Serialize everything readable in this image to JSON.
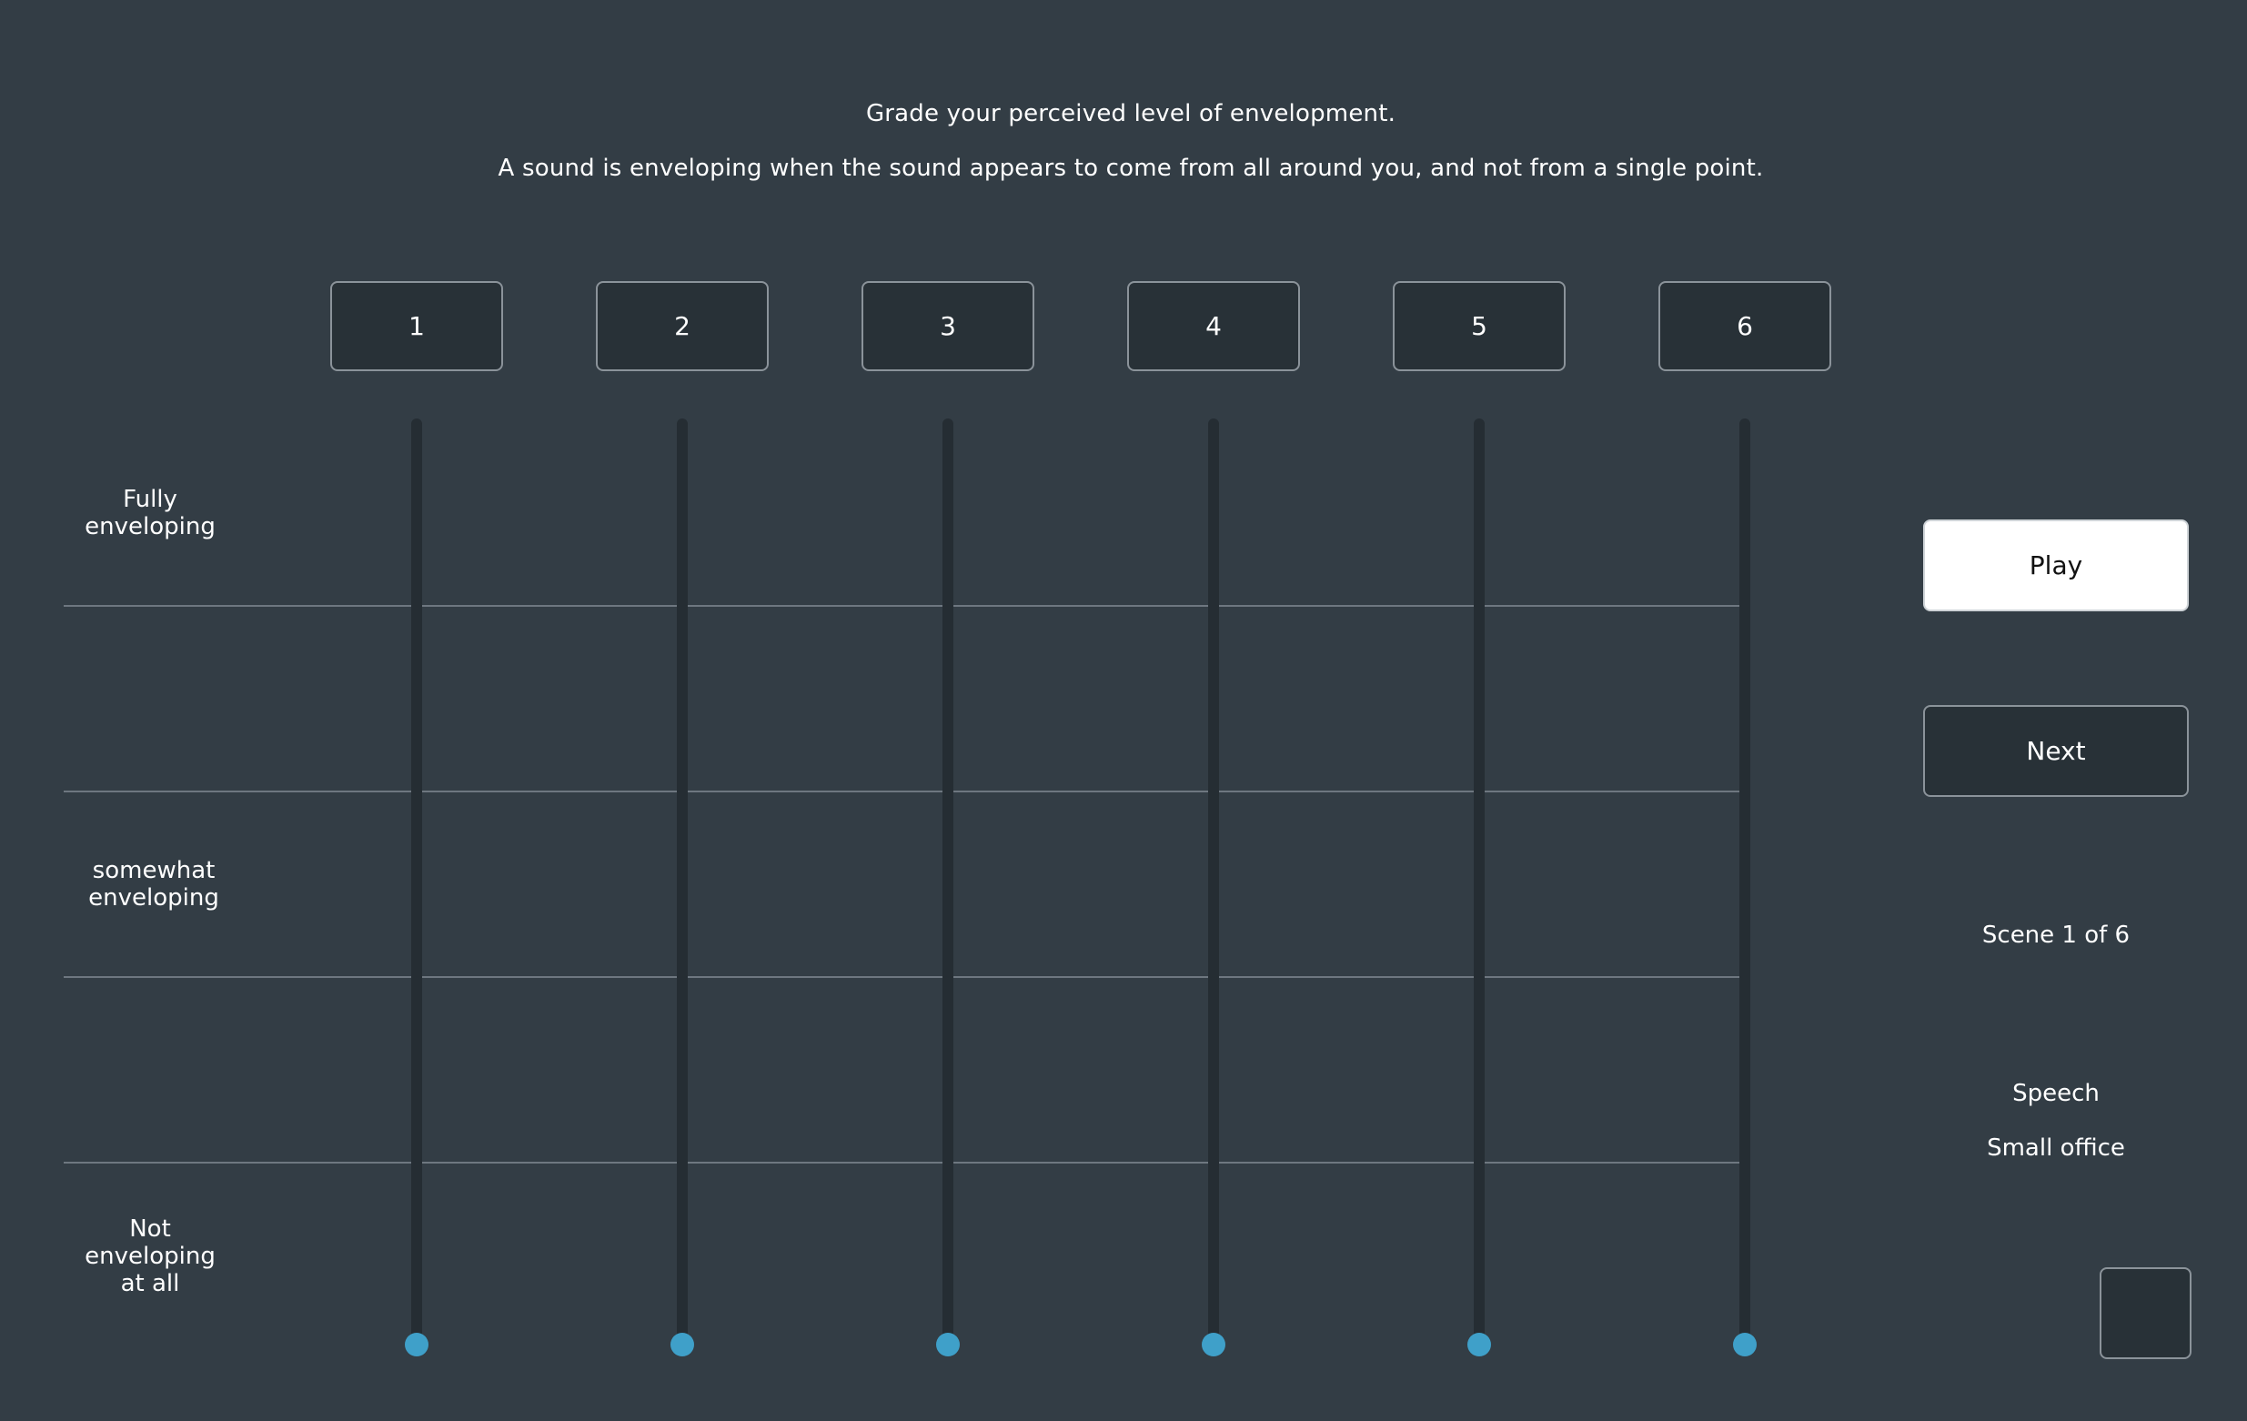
{
  "instructions": {
    "line1": "Grade your perceived level of envelopment.",
    "line2": "A sound is enveloping when the sound appears to come from all around you, and not from a single point."
  },
  "stimuli": [
    {
      "label": "1"
    },
    {
      "label": "2"
    },
    {
      "label": "3"
    },
    {
      "label": "4"
    },
    {
      "label": "5"
    },
    {
      "label": "6"
    }
  ],
  "scale": {
    "top": [
      "Fully",
      "enveloping"
    ],
    "middle": [
      "somewhat",
      "enveloping"
    ],
    "bottom": [
      "Not",
      "enveloping",
      "at all"
    ]
  },
  "sliders": {
    "values": [
      0,
      0,
      0,
      0,
      0,
      0
    ],
    "handle_color": "#3fa0c9",
    "track_color": "#252d33"
  },
  "controls": {
    "play_label": "Play",
    "next_label": "Next"
  },
  "status": {
    "scene": "Scene 1 of 6",
    "content_type": "Speech",
    "room": "Small office"
  },
  "colors": {
    "background": "#333d45",
    "button_bg": "#283137",
    "accent": "#3fa0c9"
  }
}
